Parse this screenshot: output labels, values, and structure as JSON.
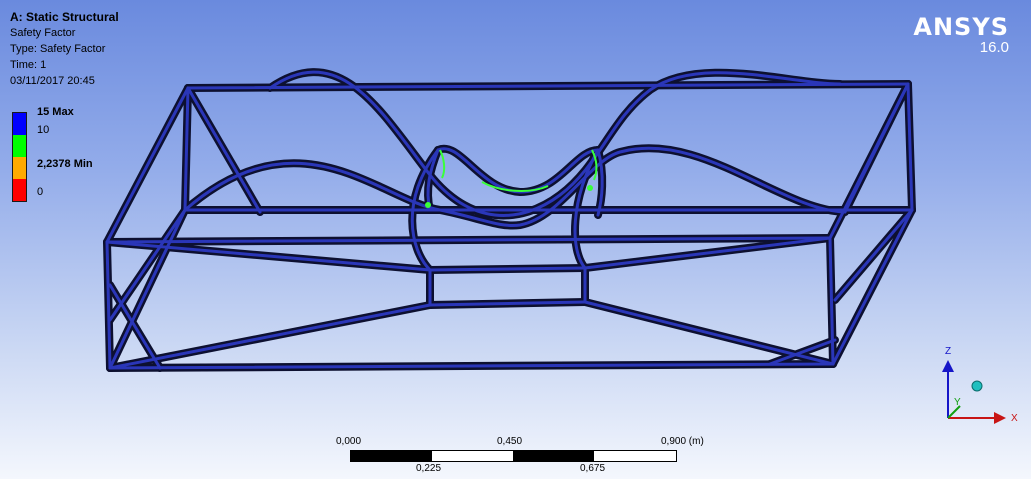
{
  "header": {
    "analysis_title": "A: Static Structural",
    "result_name": "Safety Factor",
    "result_type": "Type: Safety Factor",
    "time": "Time: 1",
    "date": "03/11/2017 20:45"
  },
  "legend": {
    "items": [
      {
        "label": "15 Max",
        "color": "#0000ff"
      },
      {
        "label": "10",
        "color": "#00ff00"
      },
      {
        "label": "2,2378 Min",
        "color": "#ffaa00"
      },
      {
        "label": "0",
        "color": "#ff0000"
      }
    ]
  },
  "logo": {
    "name": "ANSYS",
    "version": "16.0"
  },
  "triad": {
    "z_label": "Z",
    "y_label": "Y",
    "x_label": "X"
  },
  "scale_bar": {
    "top_labels": [
      "0,000",
      "0,450",
      "0,900 (m)"
    ],
    "bottom_labels": [
      "0,225",
      "0,675"
    ]
  },
  "colors": {
    "frame": "#0d1030",
    "frame_edge": "#2a36b8",
    "hotspot": "#3aff3a",
    "background_top": "#6a8ade",
    "background_bottom": "#f4f7fd"
  }
}
